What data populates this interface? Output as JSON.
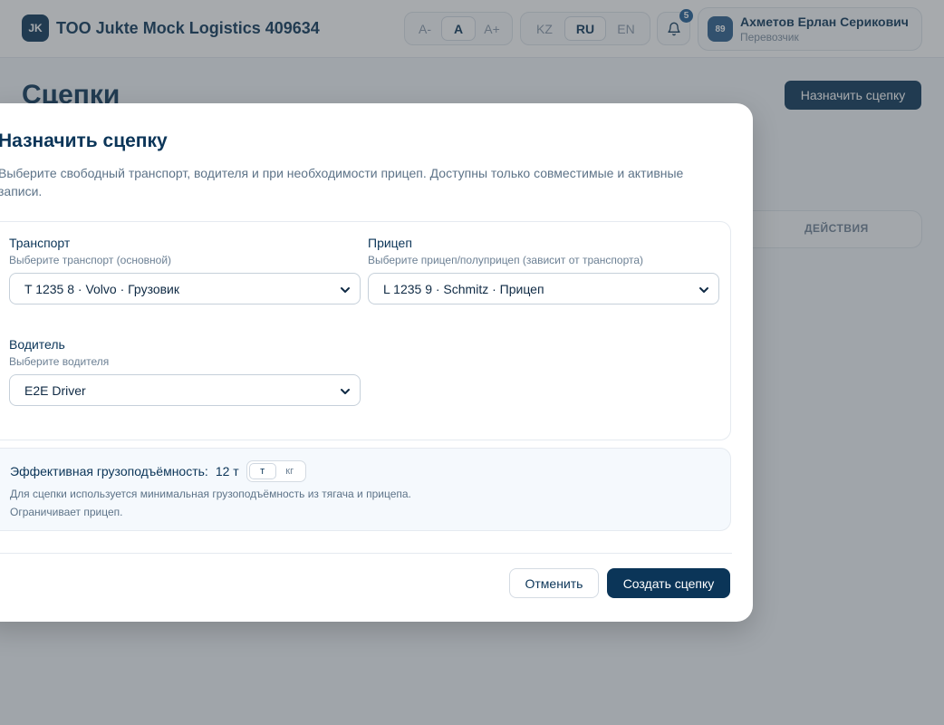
{
  "header": {
    "logo_initials": "JK",
    "company_name": "TOO Jukte Mock Logistics 409634",
    "font_sizes": [
      "A-",
      "A",
      "A+"
    ],
    "font_size_active": "A",
    "languages": [
      "KZ",
      "RU",
      "EN"
    ],
    "language_active": "RU",
    "notifications_count": "5",
    "user": {
      "avatar_text": "89",
      "name": "Ахметов Ерлан Серикович",
      "role": "Перевозчик"
    }
  },
  "page": {
    "title": "Сцепки",
    "assign_button": "Назначить сцепку",
    "table_actions_header": "ДЕЙСТВИЯ"
  },
  "modal": {
    "title": "Назначить сцепку",
    "description": "Выберите свободный транспорт, водителя и при необходимости прицеп. Доступны только совместимые и активные записи.",
    "vehicle": {
      "label": "Транспорт",
      "hint": "Выберите транспорт (основной)",
      "value": "T 1235 8 · Volvo · Грузовик"
    },
    "trailer": {
      "label": "Прицеп",
      "hint": "Выберите прицеп/полуприцеп (зависит от транспорта)",
      "value": "L 1235 9 · Schmitz · Прицеп"
    },
    "driver": {
      "label": "Водитель",
      "hint": "Выберите водителя",
      "value": "E2E Driver"
    },
    "capacity": {
      "label": "Эффективная грузоподъёмность:",
      "value": "12 т",
      "units": [
        "т",
        "кг"
      ],
      "unit_active": "т",
      "note_1": "Для сцепки используется минимальная грузоподъёмность из тягача и прицепа.",
      "note_2": "Ограничивает прицеп."
    },
    "cancel_button": "Отменить",
    "create_button": "Создать сцепку"
  },
  "colors": {
    "primary": "#0b3558",
    "accent": "#1f5e96"
  }
}
